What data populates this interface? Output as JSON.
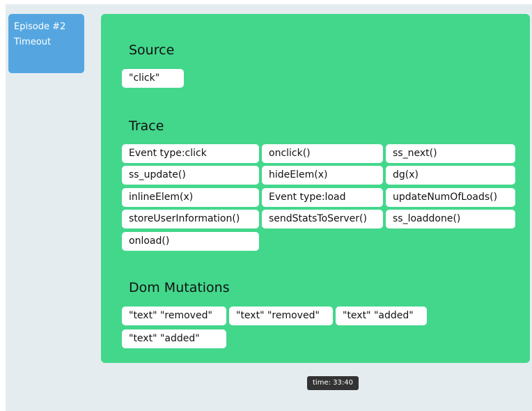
{
  "episode": {
    "title": "Episode #2",
    "status": "Timeout"
  },
  "source": {
    "heading": "Source",
    "value": "\"click\""
  },
  "trace": {
    "heading": "Trace",
    "items": [
      "Event type:click",
      "onclick()",
      "ss_next()",
      "ss_update()",
      "hideElem(x)",
      "dg(x)",
      "inlineElem(x)",
      "Event type:load",
      "updateNumOfLoads()",
      "storeUserInformation()",
      "sendStatsToServer()",
      "ss_loaddone()",
      "onload()"
    ]
  },
  "dom_mutations": {
    "heading": "Dom Mutations",
    "items": [
      "\"text\" \"removed\"",
      "\"text\" \"removed\"",
      "\"text\" \"added\"",
      "\"text\" \"added\""
    ]
  },
  "timer": {
    "label": "time: 33:40"
  },
  "colors": {
    "panel": "#43d78c",
    "episode_card": "#55a6e0",
    "background": "#e5ecf0",
    "timer": "#333333"
  }
}
